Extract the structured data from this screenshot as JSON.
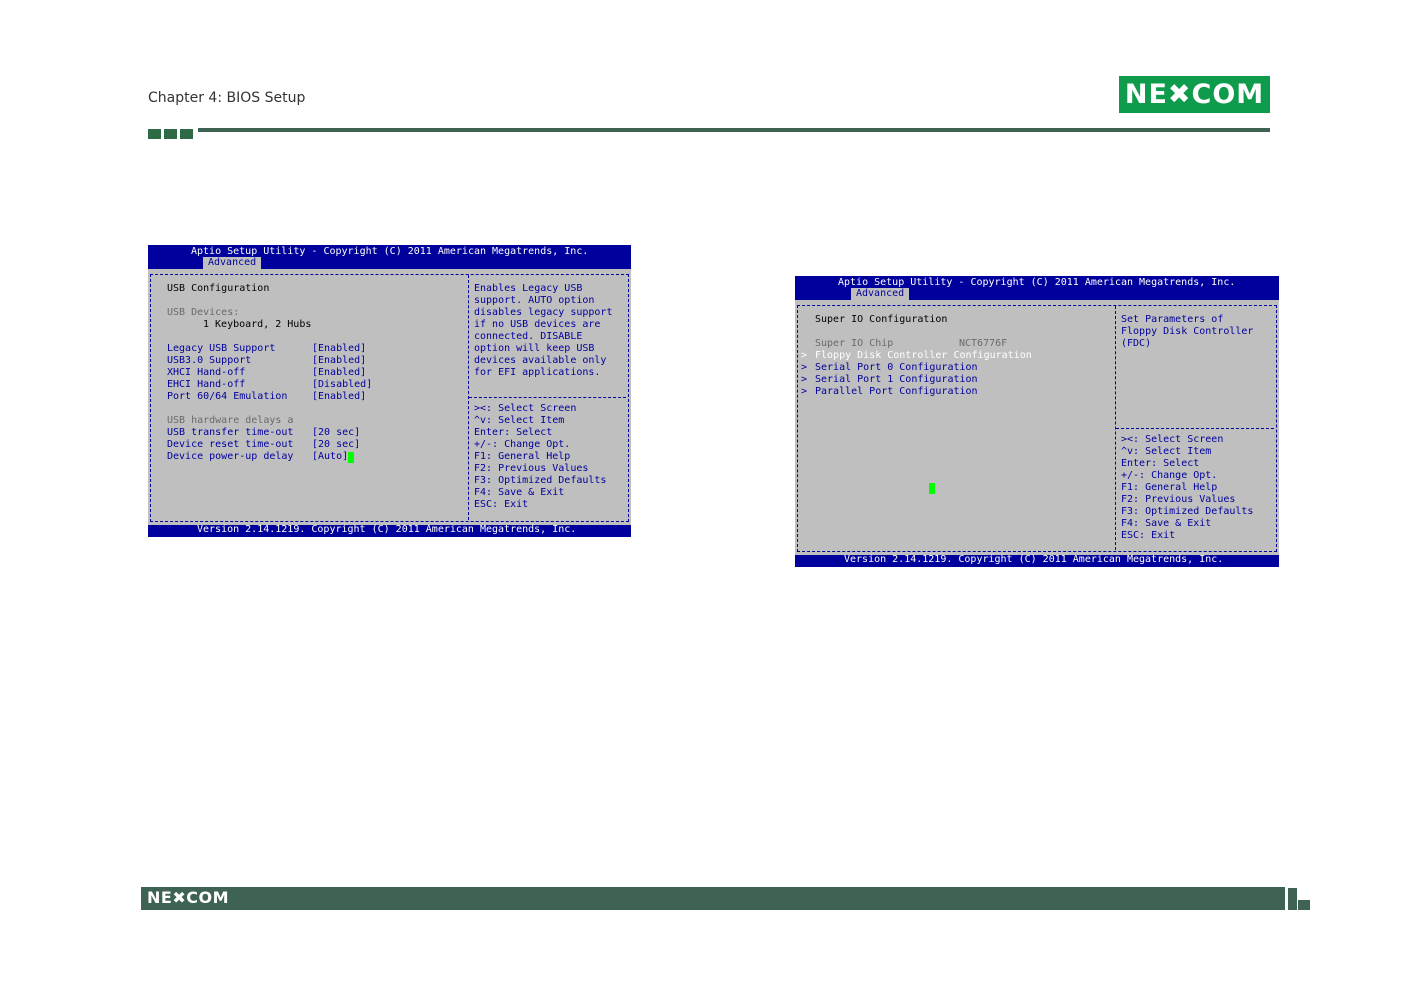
{
  "header": {
    "chapter": "Chapter 4: BIOS Setup",
    "logo": "NE✖COM",
    "accent": "#0e9b4b",
    "rule_color": "#3f6352"
  },
  "footer": {
    "logo": "NE✖COM"
  },
  "screen1": {
    "title": "Aptio Setup Utility - Copyright (C) 2011 American Megatrends, Inc.",
    "tab": "Advanced",
    "heading": "USB Configuration",
    "devices_label": "USB Devices:",
    "devices_value": "1 Keyboard, 2 Hubs",
    "settings": [
      {
        "label": "Legacy USB Support",
        "value": "[Enabled]"
      },
      {
        "label": "USB3.0 Support",
        "value": "[Enabled]"
      },
      {
        "label": "XHCI Hand-off",
        "value": "[Enabled]"
      },
      {
        "label": "EHCI Hand-off",
        "value": "[Disabled]"
      },
      {
        "label": "Port 60/64 Emulation",
        "value": "[Enabled]"
      }
    ],
    "delays_label": "USB hardware delays a",
    "delays": [
      {
        "label": "USB transfer time-out",
        "value": "[20 sec]"
      },
      {
        "label": "Device reset time-out",
        "value": "[20 sec]"
      },
      {
        "label": "Device power-up delay",
        "value": "[Auto]"
      }
    ],
    "help": [
      "Enables Legacy USB",
      "support. AUTO option",
      "disables legacy support",
      "if no USB devices are",
      "connected. DISABLE",
      "option will keep USB",
      "devices available only",
      "for EFI applications."
    ],
    "keys": [
      "><: Select Screen",
      "^v: Select Item",
      "Enter: Select",
      "+/-: Change Opt.",
      "F1: General Help",
      "F2: Previous Values",
      "F3: Optimized Defaults",
      "F4: Save & Exit",
      "ESC: Exit"
    ],
    "version": "Version 2.14.1219. Copyright (C) 2011 American Megatrends, Inc."
  },
  "screen2": {
    "title": "Aptio Setup Utility - Copyright (C) 2011 American Megatrends, Inc.",
    "tab": "Advanced",
    "heading": "Super IO Configuration",
    "chip_label": "Super IO Chip",
    "chip_value": "NCT6776F",
    "items": [
      "Floppy Disk Controller Configuration",
      "Serial Port 0 Configuration",
      "Serial Port 1 Configuration",
      "Parallel Port Configuration"
    ],
    "help": [
      "Set Parameters of",
      "Floppy Disk Controller",
      "(FDC)"
    ],
    "keys": [
      "><: Select Screen",
      "^v: Select Item",
      "Enter: Select",
      "+/-: Change Opt.",
      "F1: General Help",
      "F2: Previous Values",
      "F3: Optimized Defaults",
      "F4: Save & Exit",
      "ESC: Exit"
    ],
    "version": "Version 2.14.1219. Copyright (C) 2011 American Megatrends, Inc."
  }
}
